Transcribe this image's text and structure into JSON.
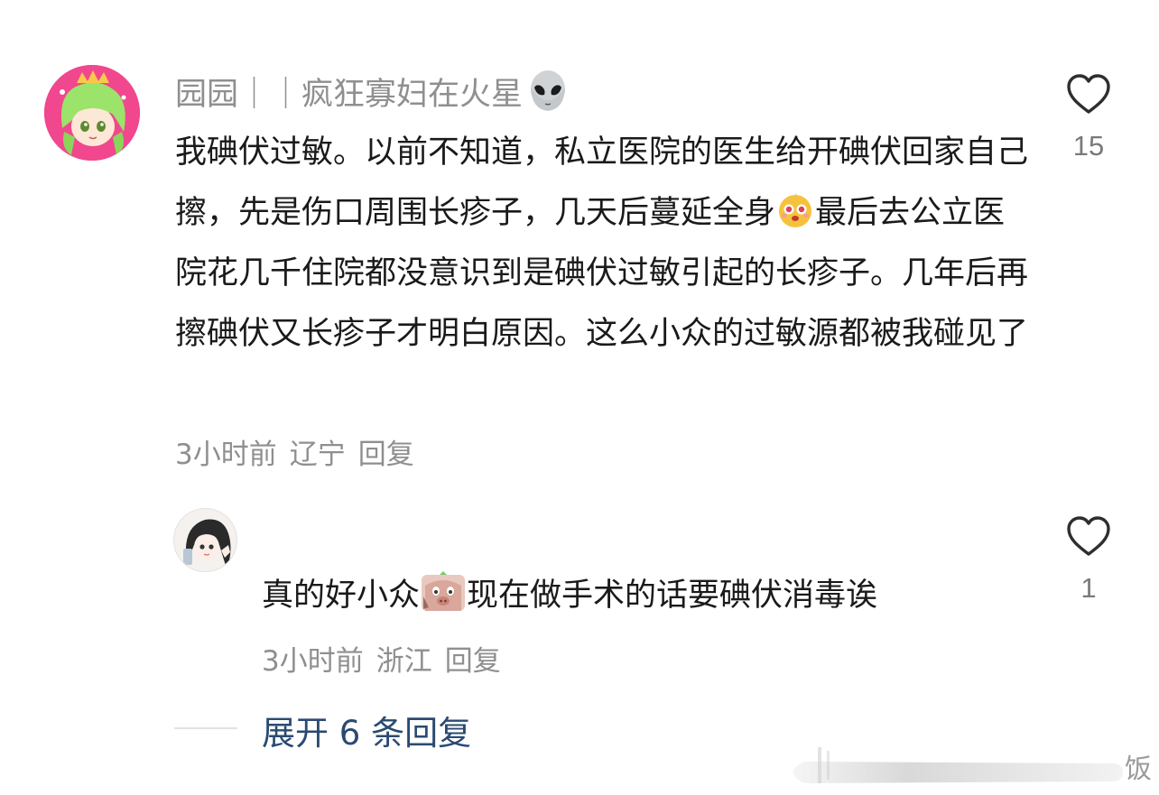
{
  "comment": {
    "username": "园园｜｜疯狂寡妇在火星",
    "username_emoji": "alien-emoji",
    "text_before_emoji": "我碘伏过敏。以前不知道，私立医院的医生给开碘伏回家自己擦，先是伤口周围长疹子，几天后蔓延全身",
    "inline_emoji": "anxious-face-emoji",
    "text_after_emoji": "最后去公立医院花几千住院都没意识到是碘伏过敏引起的长疹子。几年后再擦碘伏又长疹子才明白原因。这么小众的过敏源都被我碰见了",
    "time": "3小时前",
    "location": "辽宁",
    "reply_label": "回复",
    "like_count": "15",
    "like_icon": "heart-outline-icon"
  },
  "reply": {
    "text_before_emoji": "真的好小众",
    "inline_emoji": "pig-head-emoji",
    "text_after_emoji": "现在做手术的话要碘伏消毒诶",
    "time": "3小时前",
    "location": "浙江",
    "reply_label": "回复",
    "like_count": "1",
    "like_icon": "heart-outline-icon"
  },
  "expand": {
    "label": "展开 6 条回复"
  },
  "watermark": {
    "text": "饭"
  },
  "colors": {
    "primary_text": "#1a1a1a",
    "secondary_text": "#8f8f8f",
    "link": "#2b4a72",
    "avatar_main_bg": "#f0478e"
  }
}
